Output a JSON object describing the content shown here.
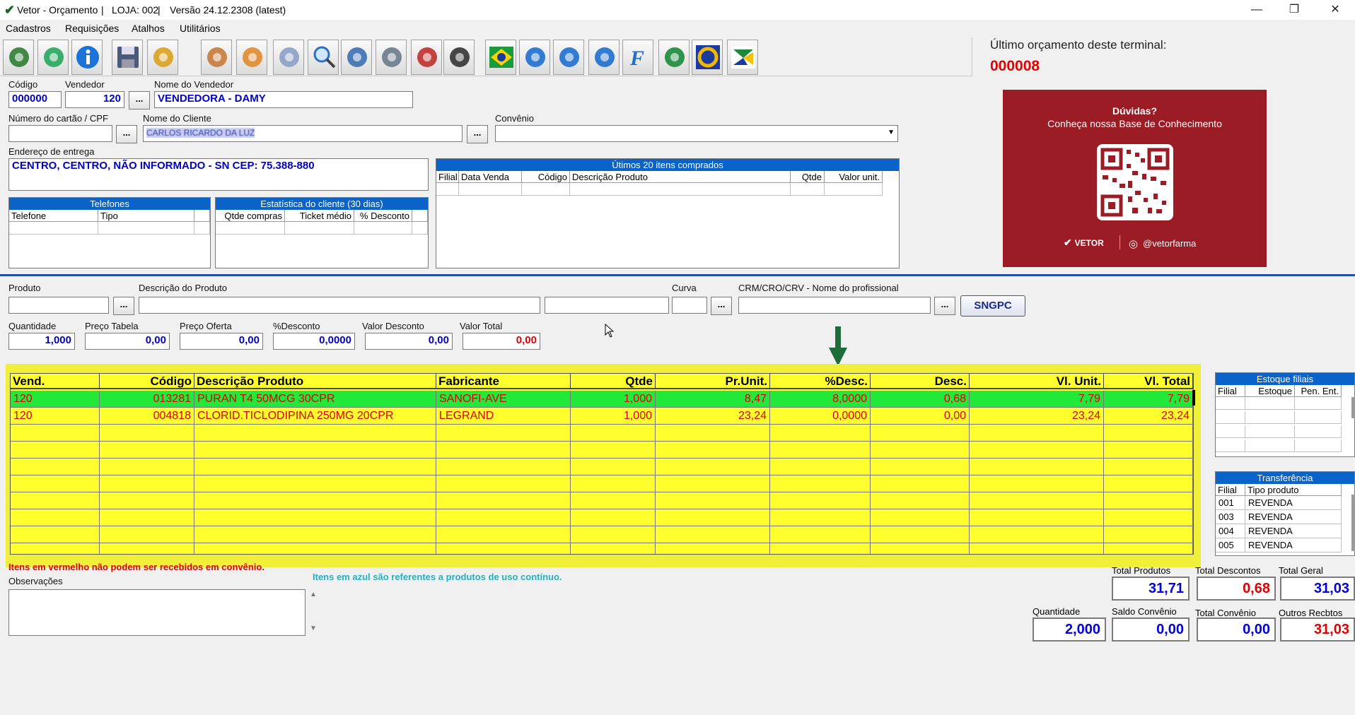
{
  "window": {
    "title": "Vetor - Orçamento",
    "store": "LOJA: 002",
    "version": "Versão 24.12.2308 (latest)",
    "sep": "|"
  },
  "menu": [
    "Cadastros",
    "Requisições",
    "Atalhos",
    "Utilitários"
  ],
  "toolbar_icons": [
    "add-user-icon",
    "refresh-icon",
    "info-icon",
    "save-icon",
    "edit-icon",
    "customers-icon",
    "customer-card-icon",
    "documents-icon",
    "search-icon",
    "book-icon",
    "user-icon",
    "delivery-icon",
    "web-cart-icon",
    "brazil-flag-icon",
    "person-run-icon",
    "dna-icon",
    "spiral-icon",
    "f-logo-icon",
    "recycle-icon",
    "ring-icon",
    "flag-icon"
  ],
  "last_quote": {
    "label": "Último orçamento deste terminal:",
    "value": "000008"
  },
  "banner": {
    "heading": "Dúvidas?",
    "subheading": "Conheça nossa Base de Conhecimento",
    "brand": "VETOR",
    "handle": "@vetorfarma",
    "bg": "#9b1c24"
  },
  "form": {
    "codigo": {
      "label": "Código",
      "value": "000000"
    },
    "vendedor": {
      "label": "Vendedor",
      "value": "120"
    },
    "nome_vendedor": {
      "label": "Nome do Vendedor",
      "value": "VENDEDORA - DAMY"
    },
    "cartao": {
      "label": "Número do cartão / CPF",
      "value": ""
    },
    "nome_cliente": {
      "label": "Nome do Cliente",
      "value": "CARLOS RICARDO DA LUZ"
    },
    "convenio": {
      "label": "Convênio",
      "value": ""
    },
    "endereco": {
      "label": "Endereço de entrega",
      "value": "CENTRO, CENTRO, NÃO INFORMADO - SN CEP: 75.388-880"
    },
    "dots": "..."
  },
  "telefones": {
    "title": "Telefones",
    "cols": [
      "Telefone",
      "Tipo"
    ]
  },
  "estatistica": {
    "title": "Estatística do cliente (30 dias)",
    "cols": [
      "Qtde compras",
      "Ticket médio",
      "% Desconto"
    ]
  },
  "ultimos": {
    "title": "Útimos 20 itens comprados",
    "cols": [
      "Filial",
      "Data Venda",
      "Código",
      "Descrição Produto",
      "Qtde",
      "Valor unit."
    ]
  },
  "produto_form": {
    "produto": "Produto",
    "descricao": "Descrição do Produto",
    "curva": "Curva",
    "crm": "CRM/CRO/CRV - Nome do profissional",
    "sngpc": "SNGPC",
    "quantidade": {
      "label": "Quantidade",
      "value": "1,000"
    },
    "preco_tabela": {
      "label": "Preço Tabela",
      "value": "0,00"
    },
    "preco_oferta": {
      "label": "Preço Oferta",
      "value": "0,00"
    },
    "desconto_pct": {
      "label": "%Desconto",
      "value": "0,0000"
    },
    "valor_desconto": {
      "label": "Valor Desconto",
      "value": "0,00"
    },
    "valor_total": {
      "label": "Valor Total",
      "value": "0,00"
    }
  },
  "items": {
    "headers": [
      "Vend.",
      "Código",
      "Descrição Produto",
      "Fabricante",
      "Qtde",
      "Pr.Unit.",
      "%Desc.",
      "Desc.",
      "Vl. Unit.",
      "Vl. Total"
    ],
    "rows": [
      [
        "120",
        "013281",
        "PURAN T4 50MCG 30CPR",
        "SANOFI-AVE",
        "1,000",
        "8,47",
        "8,0000",
        "0,68",
        "7,79",
        "7,79"
      ],
      [
        "120",
        "004818",
        "CLORID.TICLODIPINA 250MG 20CPR",
        "LEGRAND",
        "1,000",
        "23,24",
        "0,0000",
        "0,00",
        "23,24",
        "23,24"
      ]
    ],
    "selected_row_color": "#22e83a",
    "grid_color": "#ffff2e",
    "text_color": "#e00000"
  },
  "estoque": {
    "title": "Estoque filiais",
    "cols": [
      "Filial",
      "Estoque",
      "Pen. Ent."
    ]
  },
  "transferencia": {
    "title": "Transferência",
    "cols": [
      "Filial",
      "Tipo produto"
    ],
    "rows": [
      [
        "001",
        "REVENDA"
      ],
      [
        "003",
        "REVENDA"
      ],
      [
        "004",
        "REVENDA"
      ],
      [
        "005",
        "REVENDA"
      ]
    ]
  },
  "notes": {
    "red": "Itens em vermelho não podem ser recebidos em convênio.",
    "blue": "Itens em azul são referentes a produtos de uso contínuo.",
    "obs_label": "Observações"
  },
  "totals": {
    "total_produtos": {
      "label": "Total Produtos",
      "value": "31,71"
    },
    "total_descontos": {
      "label": "Total Descontos",
      "value": "0,68"
    },
    "total_geral": {
      "label": "Total Geral",
      "value": "31,03"
    },
    "quantidade": {
      "label": "Quantidade",
      "value": "2,000"
    },
    "saldo_convenio": {
      "label": "Saldo Convênio",
      "value": "0,00"
    },
    "total_convenio": {
      "label": "Total Convênio",
      "value": "0,00"
    },
    "outros_recbtos": {
      "label": "Outros Recbtos",
      "value": "31,03"
    }
  }
}
